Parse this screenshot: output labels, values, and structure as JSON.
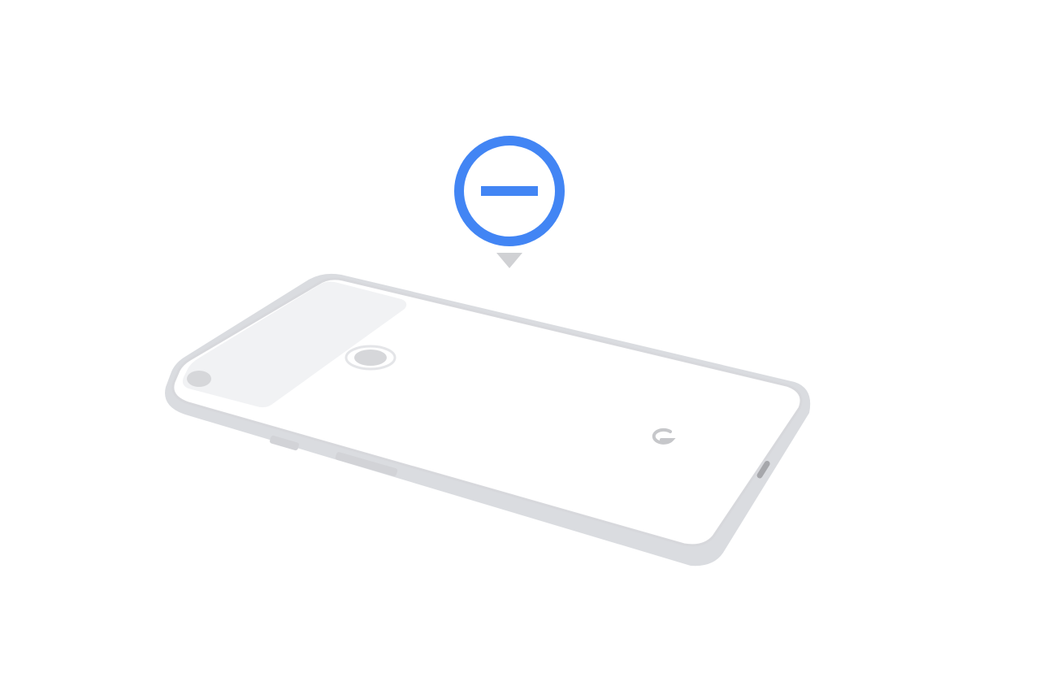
{
  "illustration": {
    "subject": "phone-face-down",
    "status_icon": "do-not-disturb-icon",
    "brand_mark": "G"
  },
  "colors": {
    "background": "#ffffff",
    "accent_blue": "#4285f4",
    "phone_edge": "#dadce0",
    "phone_outline": "#d7d8dc",
    "phone_back": "#ffffff",
    "camera_bar": "#f1f2f4",
    "lens": "#d6d7da",
    "pointer": "#d0d1d4",
    "brand_mark": "#c6c7ca"
  }
}
